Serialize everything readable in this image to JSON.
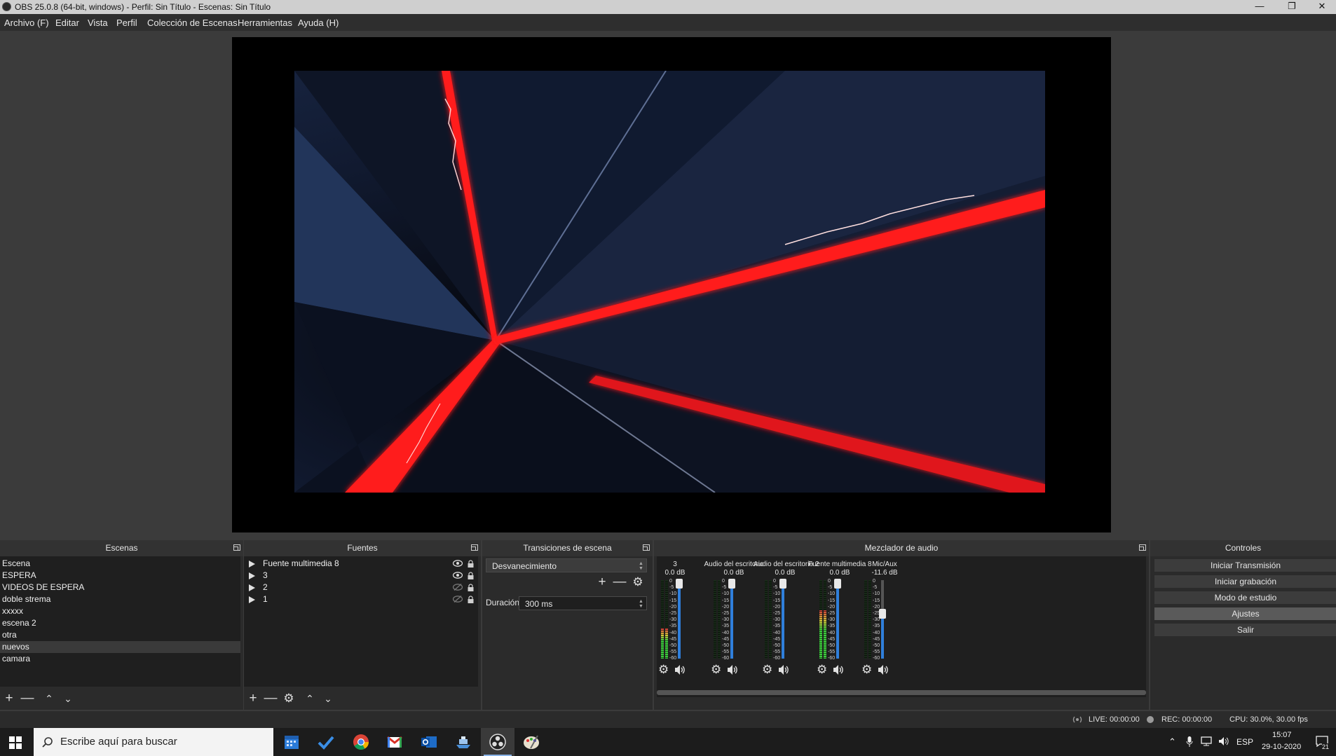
{
  "window": {
    "title": "OBS 25.0.8 (64-bit, windows) - Perfil: Sin Título - Escenas: Sin Título"
  },
  "menu": [
    "Archivo (F)",
    "Editar",
    "Vista",
    "Perfil",
    "Colección de Escenas",
    "Herramientas",
    "Ayuda (H)"
  ],
  "scenes": {
    "title": "Escenas",
    "items": [
      "Escena",
      "ESPERA",
      "VIDEOS DE ESPERA",
      "doble strema",
      "xxxxx",
      "escena 2",
      "otra",
      "nuevos",
      "camara"
    ],
    "selected": "nuevos"
  },
  "sources": {
    "title": "Fuentes",
    "items": [
      {
        "label": "Fuente multimedia 8",
        "visible": true
      },
      {
        "label": "3",
        "visible": true
      },
      {
        "label": "2",
        "visible": false
      },
      {
        "label": "1",
        "visible": false
      }
    ]
  },
  "transitions": {
    "title": "Transiciones de escena",
    "selected": "Desvanecimiento",
    "duration_label": "Duración",
    "duration_value": "300 ms"
  },
  "mixer": {
    "title": "Mezclador de audio",
    "scale": [
      "0",
      "-5",
      "-10",
      "-15",
      "-20",
      "-25",
      "-30",
      "-35",
      "-40",
      "-45",
      "-50",
      "-55",
      "-60"
    ],
    "channels": [
      {
        "name": "3",
        "db": "0.0 dB",
        "level": 0.38,
        "fader": 1.0
      },
      {
        "name": "Audio del escritorio",
        "db": "0.0 dB",
        "level": 0.0,
        "fader": 1.0
      },
      {
        "name": "Audio del escritorio 2",
        "db": "0.0 dB",
        "level": 0.0,
        "fader": 1.0
      },
      {
        "name": "Fuente multimedia 8",
        "db": "0.0 dB",
        "level": 0.62,
        "fader": 1.0
      },
      {
        "name": "Mic/Aux",
        "db": "-11.6 dB",
        "level": 0.0,
        "fader": 0.62
      }
    ]
  },
  "controls": {
    "title": "Controles",
    "buttons": [
      "Iniciar Transmisión",
      "Iniciar grabación",
      "Modo de estudio",
      "Ajustes",
      "Salir"
    ],
    "active": "Ajustes"
  },
  "status": {
    "live": "LIVE: 00:00:00",
    "rec": "REC: 00:00:00",
    "cpu": "CPU: 30.0%, 30.00 fps"
  },
  "taskbar": {
    "search_placeholder": "Escribe aquí para buscar",
    "language": "ESP",
    "time": "15:07",
    "date": "29-10-2020",
    "notifications": "21"
  },
  "colors": {
    "accent_blue": "#2f7fdb",
    "laser_red": "#ff1a1a",
    "panel": "#2b2b2b",
    "list_bg": "#1f1f1f"
  }
}
